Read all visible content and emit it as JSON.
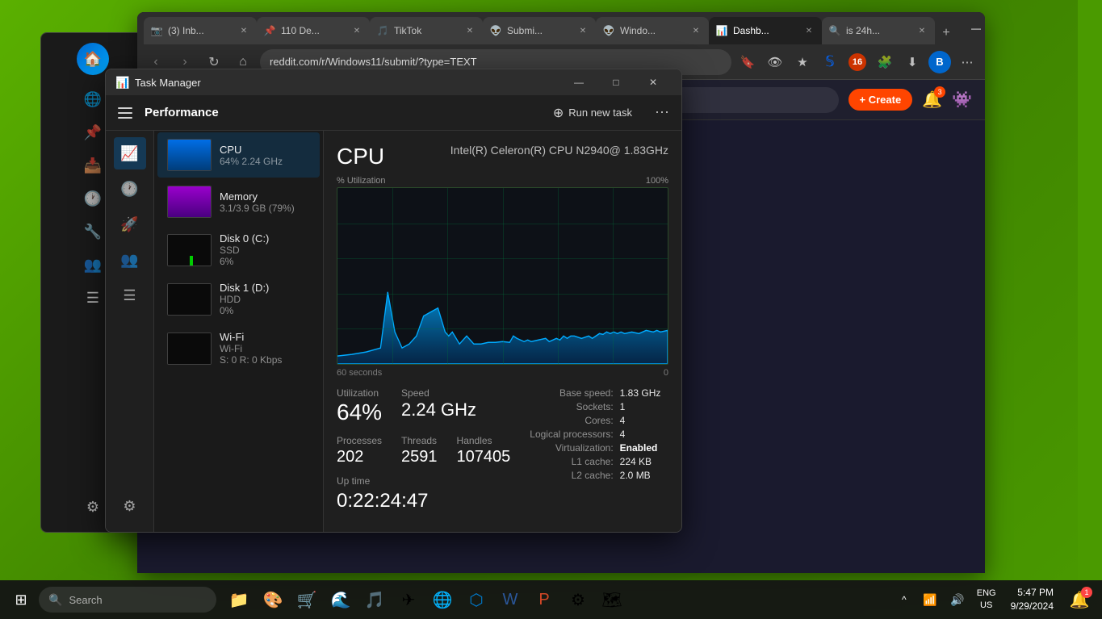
{
  "desktop": {
    "background_color": "#4a9a00"
  },
  "taskbar": {
    "search_placeholder": "Search",
    "time": "5:47 PM",
    "date": "9/29/2024",
    "language": "ENG\nUS",
    "lang_line1": "ENG",
    "lang_line2": "US",
    "start_icon": "⊞",
    "notification_badge": "1"
  },
  "browser": {
    "tabs": [
      {
        "id": "tab1",
        "favicon": "📷",
        "title": "(3) Inb...",
        "active": false
      },
      {
        "id": "tab2",
        "favicon": "📌",
        "title": "110 De...",
        "active": false
      },
      {
        "id": "tab3",
        "favicon": "🎵",
        "title": "TikTok",
        "active": false
      },
      {
        "id": "tab4",
        "favicon": "👽",
        "title": "Submi...",
        "active": false
      },
      {
        "id": "tab5",
        "favicon": "👽",
        "title": "Windo...",
        "active": false
      },
      {
        "id": "tab6",
        "favicon": "📊",
        "title": "Dashb...",
        "active": true
      },
      {
        "id": "tab7",
        "favicon": "🔍",
        "title": "is 24h...",
        "active": false
      }
    ],
    "address": "reddit.com/r/Windows11/submit/?type=TEXT",
    "new_tab_icon": "+",
    "back_icon": "←",
    "forward_icon": "→",
    "refresh_icon": "↻",
    "home_icon": "⌂"
  },
  "task_manager": {
    "title": "Task Manager",
    "toolbar_title": "Performance",
    "run_task_label": "Run new task",
    "selected_item": "CPU",
    "cpu": {
      "title": "CPU",
      "model": "Intel(R) Celeron(R) CPU N2940@ 1.83GHz",
      "utilization_label": "% Utilization",
      "utilization_max": "100%",
      "utilization_pct": 64,
      "time_label": "60 seconds",
      "time_right": "0",
      "stats": {
        "utilization_label": "Utilization",
        "utilization_value": "64%",
        "speed_label": "Speed",
        "speed_value": "2.24 GHz",
        "processes_label": "Processes",
        "processes_value": "202",
        "threads_label": "Threads",
        "threads_value": "2591",
        "handles_label": "Handles",
        "handles_value": "107405",
        "uptime_label": "Up time",
        "uptime_value": "0:22:24:47"
      },
      "info": {
        "base_speed_label": "Base speed:",
        "base_speed_value": "1.83 GHz",
        "sockets_label": "Sockets:",
        "sockets_value": "1",
        "cores_label": "Cores:",
        "cores_value": "4",
        "logical_processors_label": "Logical processors:",
        "logical_processors_value": "4",
        "virtualization_label": "Virtualization:",
        "virtualization_value": "Enabled",
        "l1_cache_label": "L1 cache:",
        "l1_cache_value": "224 KB",
        "l2_cache_label": "L2 cache:",
        "l2_cache_value": "2.0 MB"
      }
    },
    "sidebar_items": [
      {
        "id": "menu",
        "icon": "≡",
        "label": "Menu",
        "active": false
      },
      {
        "id": "performance",
        "icon": "📈",
        "label": "Performance",
        "active": true
      },
      {
        "id": "app_history",
        "icon": "🕐",
        "label": "App history",
        "active": false
      },
      {
        "id": "startup",
        "icon": "🚀",
        "label": "Startup",
        "active": false
      },
      {
        "id": "users",
        "icon": "👥",
        "label": "Users",
        "active": false
      },
      {
        "id": "details",
        "icon": "☰",
        "label": "Details",
        "active": false
      },
      {
        "id": "services",
        "icon": "⚙",
        "label": "Services",
        "active": false
      }
    ],
    "device_list": [
      {
        "id": "cpu",
        "name": "CPU",
        "sub": "64%  2.24 GHz",
        "type": "cpu",
        "active": true
      },
      {
        "id": "memory",
        "name": "Memory",
        "sub": "3.1/3.9 GB (79%)",
        "type": "memory",
        "active": false
      },
      {
        "id": "disk0",
        "name": "Disk 0 (C:)",
        "sub2": "SSD",
        "sub": "6%",
        "type": "disk0",
        "active": false
      },
      {
        "id": "disk1",
        "name": "Disk 1 (D:)",
        "sub2": "HDD",
        "sub": "0%",
        "type": "disk1",
        "active": false
      },
      {
        "id": "wifi",
        "name": "Wi-Fi",
        "sub2": "Wi-Fi",
        "sub": "S: 0  R: 0 Kbps",
        "type": "wifi",
        "active": false
      }
    ]
  },
  "settings": {
    "title": "Settings",
    "nav_items": [
      {
        "id": "pin",
        "icon": "📌",
        "label": ""
      },
      {
        "id": "import",
        "icon": "📥",
        "label": ""
      },
      {
        "id": "history",
        "icon": "🕐",
        "label": ""
      },
      {
        "id": "tools",
        "icon": "🔧",
        "label": ""
      },
      {
        "id": "groups",
        "icon": "👥",
        "label": ""
      },
      {
        "id": "list",
        "icon": "☰",
        "label": ""
      },
      {
        "id": "gear",
        "icon": "⚙",
        "label": ""
      }
    ]
  },
  "icons": {
    "hamburger": "≡",
    "close": "✕",
    "minimize": "—",
    "maximize": "□",
    "chevron_down": "⌄",
    "back": "‹",
    "forward": "›",
    "search": "🔍",
    "bell": "🔔",
    "wifi": "📶",
    "volume": "🔊",
    "battery": "🔋",
    "windows": "⊞",
    "run_task": "⊕"
  }
}
